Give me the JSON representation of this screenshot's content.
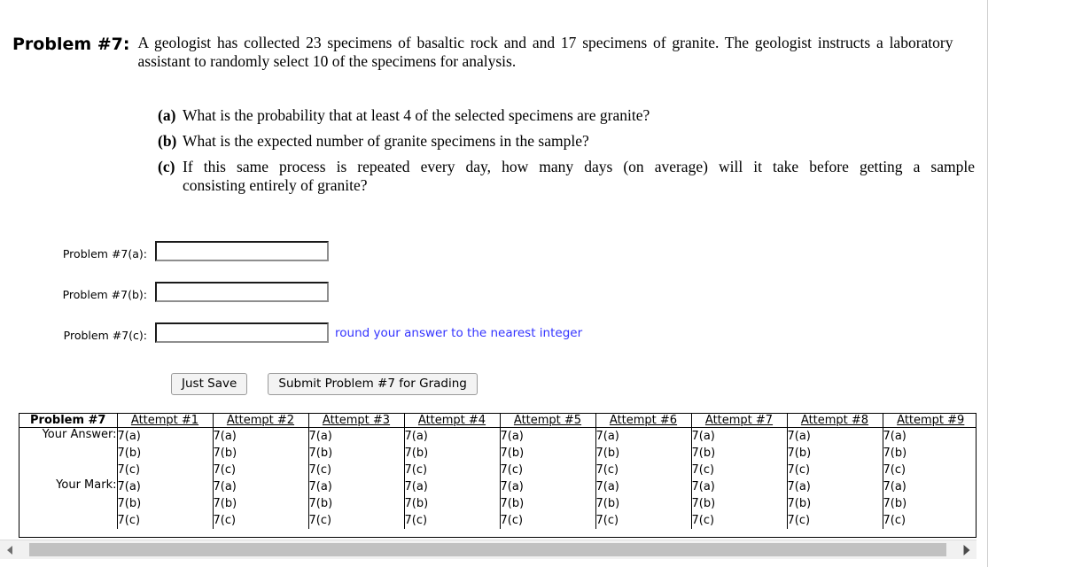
{
  "problem": {
    "label": "Problem #7:",
    "statement": "A geologist has collected 23 specimens of basaltic rock and and 17 specimens of granite. The geologist instructs a laboratory assistant to randomly select 10 of the specimens for analysis.",
    "subparts": [
      {
        "tag": "(a)",
        "text": "What is the probability that at least 4 of the selected specimens are granite?"
      },
      {
        "tag": "(b)",
        "text": "What is the expected number of granite specimens in the sample?"
      },
      {
        "tag": "(c)",
        "line1": "If this same process is repeated every day, how many days (on average) will it take before getting a sample",
        "line2": "consisting entirely of granite?"
      }
    ]
  },
  "answer_fields": [
    {
      "label": "Problem #7(a):",
      "value": "",
      "placeholder": "",
      "hint": ""
    },
    {
      "label": "Problem #7(b):",
      "value": "",
      "placeholder": "",
      "hint": ""
    },
    {
      "label": "Problem #7(c):",
      "value": "",
      "placeholder": "",
      "hint": "round your answer to the nearest integer"
    }
  ],
  "buttons": {
    "save_label": "Just Save",
    "submit_label": "Submit Problem #7 for Grading"
  },
  "results_table": {
    "corner_header": "Problem #7",
    "attempt_headers": [
      "Attempt #1",
      "Attempt #2",
      "Attempt #3",
      "Attempt #4",
      "Attempt #5",
      "Attempt #6",
      "Attempt #7",
      "Attempt #8",
      "Attempt #9"
    ],
    "rows": [
      {
        "label": "Your Answer:",
        "cells": [
          [
            "7(a)",
            "7(b)",
            "7(c)"
          ],
          [
            "7(a)",
            "7(b)",
            "7(c)"
          ],
          [
            "7(a)",
            "7(b)",
            "7(c)"
          ],
          [
            "7(a)",
            "7(b)",
            "7(c)"
          ],
          [
            "7(a)",
            "7(b)",
            "7(c)"
          ],
          [
            "7(a)",
            "7(b)",
            "7(c)"
          ],
          [
            "7(a)",
            "7(b)",
            "7(c)"
          ],
          [
            "7(a)",
            "7(b)",
            "7(c)"
          ],
          [
            "7(a)",
            "7(b)",
            "7(c)"
          ]
        ]
      },
      {
        "label": "Your Mark:",
        "cells": [
          [
            "7(a)",
            "7(b)",
            "7(c)"
          ],
          [
            "7(a)",
            "7(b)",
            "7(c)"
          ],
          [
            "7(a)",
            "7(b)",
            "7(c)"
          ],
          [
            "7(a)",
            "7(b)",
            "7(c)"
          ],
          [
            "7(a)",
            "7(b)",
            "7(c)"
          ],
          [
            "7(a)",
            "7(b)",
            "7(c)"
          ],
          [
            "7(a)",
            "7(b)",
            "7(c)"
          ],
          [
            "7(a)",
            "7(b)",
            "7(c)"
          ],
          [
            "7(a)",
            "7(b)",
            "7(c)"
          ]
        ]
      }
    ]
  },
  "scrollbar": {
    "left_arrow_icon": "triangle-left-icon",
    "right_arrow_icon": "triangle-right-icon"
  },
  "colors": {
    "hint_blue": "#3333ff",
    "border_black": "#000000",
    "scrollbar_thumb": "#c1c1c1"
  }
}
